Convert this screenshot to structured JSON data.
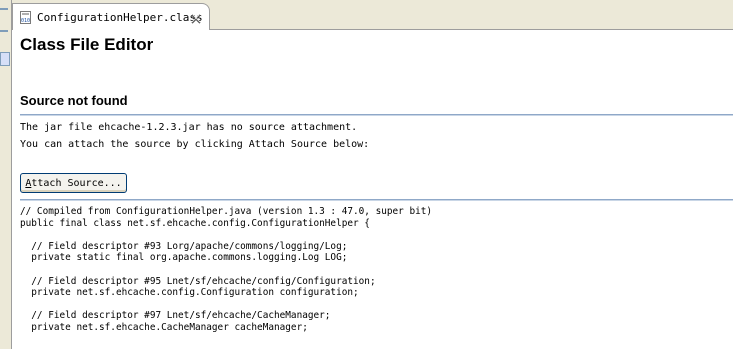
{
  "tab": {
    "title": "ConfigurationHelper.class",
    "icon": "class-file-icon",
    "close_icon": "close-icon"
  },
  "editor": {
    "title": "Class File Editor",
    "section_title": "Source not found",
    "message_line1": "The jar file ehcache-1.2.3.jar has no source attachment.",
    "message_line2": "You can attach the source by clicking Attach Source below:",
    "attach_button": {
      "mnemonic": "A",
      "rest": "ttach Source..."
    }
  },
  "code_lines": [
    "// Compiled from ConfigurationHelper.java (version 1.3 : 47.0, super bit)",
    "public final class net.sf.ehcache.config.ConfigurationHelper {",
    "",
    "  // Field descriptor #93 Lorg/apache/commons/logging/Log;",
    "  private static final org.apache.commons.logging.Log LOG;",
    "",
    "  // Field descriptor #95 Lnet/sf/ehcache/config/Configuration;",
    "  private net.sf.ehcache.config.Configuration configuration;",
    "",
    "  // Field descriptor #97 Lnet/sf/ehcache/CacheManager;",
    "  private net.sf.ehcache.CacheManager cacheManager;"
  ],
  "colors": {
    "chrome": "#ece9d8",
    "separator": "#8fa8c8",
    "button_border": "#003c74"
  }
}
